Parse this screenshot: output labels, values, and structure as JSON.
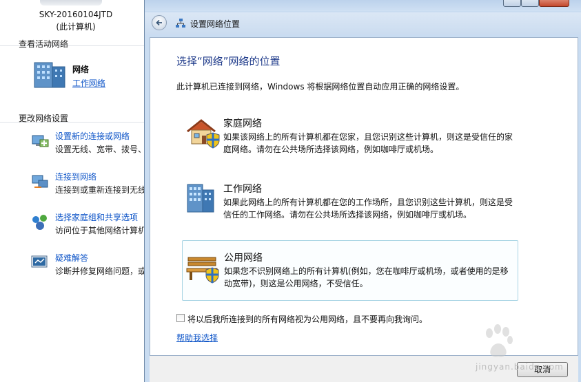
{
  "background": {
    "computer_name": "SKY-20160104JTD",
    "computer_sub": "(此计算机)",
    "active_networks_title": "查看活动网络",
    "network_name": "网络",
    "network_type": "工作网络",
    "change_settings_title": "更改网络设置",
    "tasks": [
      {
        "link": "设置新的连接或网络",
        "desc": "设置无线、宽带、拨号、",
        "icon": "new-connection-icon"
      },
      {
        "link": "连接到网络",
        "desc": "连接到或重新连接到无线",
        "icon": "connect-network-icon"
      },
      {
        "link": "选择家庭组和共享选项",
        "desc": "访问位于其他网络计算机",
        "icon": "homegroup-icon"
      },
      {
        "link": "疑难解答",
        "desc": "诊断并修复网络问题，或",
        "icon": "troubleshoot-icon"
      }
    ]
  },
  "dialog": {
    "title": "设置网络位置",
    "heading": "选择“网络”网络的位置",
    "intro": "此计算机已连接到网络，Windows 将根据网络位置自动应用正确的网络设置。",
    "options": [
      {
        "title": "家庭网络",
        "desc": "如果该网络上的所有计算机都在您家，且您识别这些计算机，则这是受信任的家庭网络。请勿在公共场所选择该网络，例如咖啡厅或机场。",
        "icon": "home-network-icon",
        "selected": false
      },
      {
        "title": "工作网络",
        "desc": "如果此网络上的所有计算机都在您的工作场所，且您识别这些计算机，则这是受信任的工作网络。请勿在公共场所选择该网络，例如咖啡厅或机场。",
        "icon": "work-network-icon",
        "selected": false
      },
      {
        "title": "公用网络",
        "desc": "如果您不识别网络上的所有计算机(例如，您在咖啡厅或机场，或者使用的是移动宽带)，则这是公用网络，不受信任。",
        "icon": "public-network-icon",
        "selected": true
      }
    ],
    "checkbox_label": "将以后我所连接到的所有网络视为公用网络，且不要再向我询问。",
    "checkbox_checked": false,
    "help_link": "帮助我选择",
    "cancel_label": "取消"
  },
  "watermark": {
    "brand": "Baidu经验",
    "url": "jingyan.baidu.com"
  },
  "colors": {
    "accent_link": "#0a52c7",
    "heading": "#1e3a8a",
    "selected_border": "#a6d3e3"
  }
}
